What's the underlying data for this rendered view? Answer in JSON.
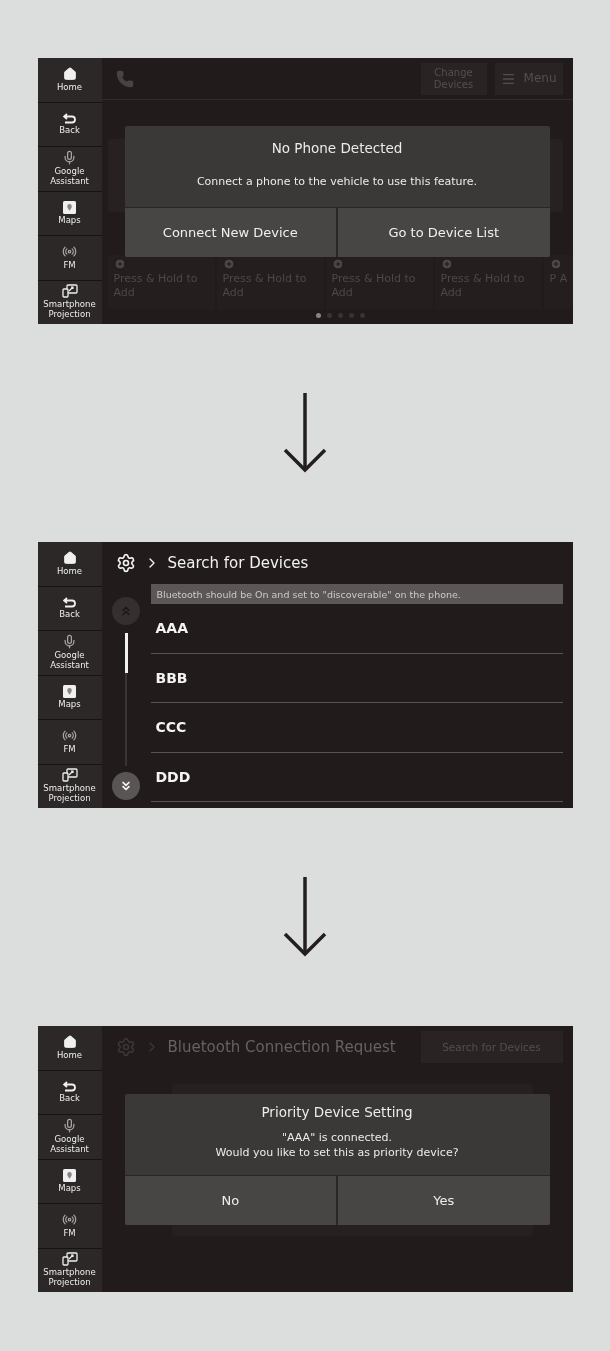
{
  "screens": [
    {
      "kind": "phone",
      "sidebar": [
        "Home",
        "Back",
        "Google Assistant",
        "Maps",
        "FM",
        "Smartphone Projection"
      ],
      "change_devices_button": "Change Devices",
      "menu_button": "Menu",
      "tiles": [
        "Press & Hold to Add",
        "Press & Hold to Add",
        "Press & Hold to Add",
        "Press & Hold to Add",
        "P A"
      ],
      "page_dots": [
        {
          "selected": true
        },
        {
          "selected": false
        },
        {
          "selected": false
        },
        {
          "selected": false
        },
        {
          "selected": false
        }
      ],
      "dialog": {
        "title": "No Phone Detected",
        "message": [
          "Connect a phone to the vehicle to use this feature."
        ],
        "buttons": [
          "Connect New Device",
          "Go to Device List"
        ]
      }
    },
    {
      "kind": "search",
      "sidebar": [
        "Home",
        "Back",
        "Google Assistant",
        "Maps",
        "FM",
        "Smartphone Projection"
      ],
      "breadcrumb": "Search for Devices",
      "notice": "Bluetooth should be On and set to \"discoverable\" on the phone.",
      "devices": [
        "AAA",
        "BBB",
        "CCC",
        "DDD"
      ]
    },
    {
      "kind": "priority",
      "sidebar": [
        "Home",
        "Back",
        "Google Assistant",
        "Maps",
        "FM",
        "Smartphone Projection"
      ],
      "breadcrumb": "Bluetooth Connection Request",
      "header_button": "Search for Devices",
      "dialog": {
        "title": "Priority Device Setting",
        "message": [
          "\"AAA\" is connected.",
          "Would you like to set this as priority device?"
        ],
        "buttons": [
          "No",
          "Yes"
        ]
      }
    }
  ]
}
